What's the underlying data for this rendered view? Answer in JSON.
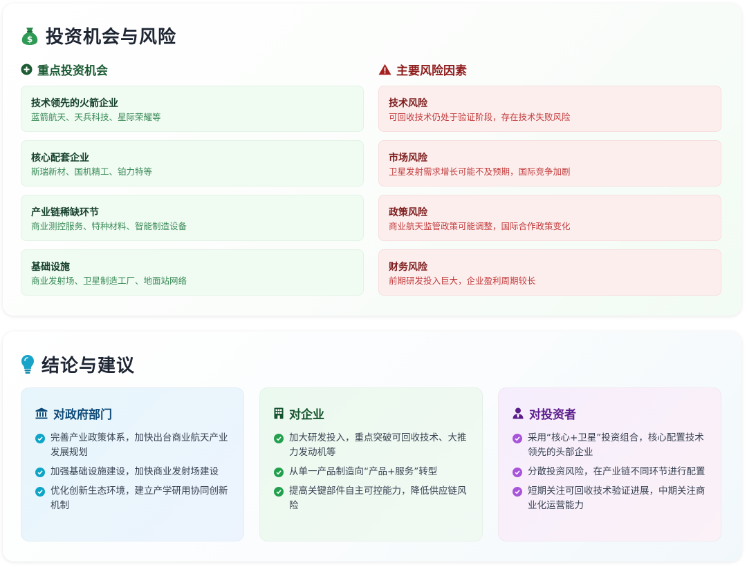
{
  "invest": {
    "title": "投资机会与风险",
    "opportunities": {
      "heading": "重点投资机会",
      "items": [
        {
          "title": "技术领先的火箭企业",
          "desc": "蓝箭航天、天兵科技、星际荣耀等"
        },
        {
          "title": "核心配套企业",
          "desc": "斯瑞新材、国机精工、铂力特等"
        },
        {
          "title": "产业链稀缺环节",
          "desc": "商业测控服务、特种材料、智能制造设备"
        },
        {
          "title": "基础设施",
          "desc": "商业发射场、卫星制造工厂、地面站网络"
        }
      ]
    },
    "risks": {
      "heading": "主要风险因素",
      "items": [
        {
          "title": "技术风险",
          "desc": "可回收技术仍处于验证阶段，存在技术失败风险"
        },
        {
          "title": "市场风险",
          "desc": "卫星发射需求增长可能不及预期，国际竞争加剧"
        },
        {
          "title": "政策风险",
          "desc": "商业航天监管政策可能调整，国际合作政策变化"
        },
        {
          "title": "财务风险",
          "desc": "前期研发投入巨大，企业盈利周期较长"
        }
      ]
    }
  },
  "conclusion": {
    "title": "结论与建议",
    "government": {
      "heading": "对政府部门",
      "items": [
        "完善产业政策体系，加快出台商业航天产业发展规划",
        "加强基础设施建设，加快商业发射场建设",
        "优化创新生态环境，建立产学研用协同创新机制"
      ]
    },
    "enterprise": {
      "heading": "对企业",
      "items": [
        "加大研发投入，重点突破可回收技术、大推力发动机等",
        "从单一产品制造向“产品+服务”转型",
        "提高关键部件自主可控能力，降低供应链风险"
      ]
    },
    "investor": {
      "heading": "对投资者",
      "items": [
        "采用“核心+卫星”投资组合，核心配置技术领先的头部企业",
        "分散投资风险，在产业链不同环节进行配置",
        "短期关注可回收技术验证进展，中期关注商业化运营能力"
      ]
    }
  },
  "colors": {
    "opportunity_green": "#1c5b34",
    "risk_red": "#8f1d1d",
    "gov_accent": "#0ea5c6",
    "enterprise_accent": "#22a04e",
    "investor_accent": "#a855d9"
  },
  "icons": {
    "invest_title": "money-bag-icon",
    "opportunities": "plus-circle-icon",
    "risks": "warning-triangle-icon",
    "conclusion_title": "lightbulb-icon",
    "government": "landmark-icon",
    "enterprise": "building-icon",
    "investor": "user-tie-icon",
    "list_bullet": "check-circle-icon"
  }
}
